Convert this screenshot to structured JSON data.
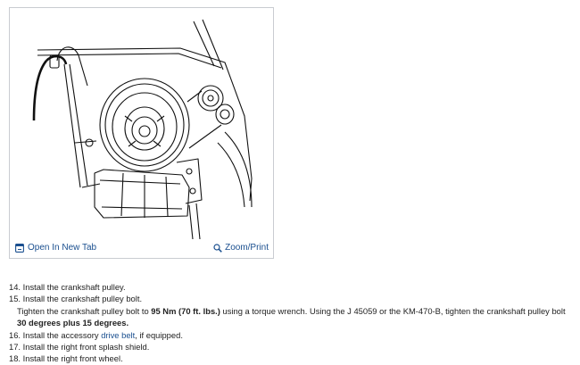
{
  "figure": {
    "open_label": "Open In New Tab",
    "zoom_label": "Zoom/Print",
    "open_icon": "new-tab-icon",
    "zoom_icon": "magnifier-icon"
  },
  "steps": {
    "s14": "14. Install the crankshaft pulley.",
    "s15": "15. Install the crankshaft pulley bolt.",
    "torque_pre": "Tighten the crankshaft pulley bolt to ",
    "torque_value": "95 Nm (70 ft. lbs.)",
    "torque_mid": " using a torque wrench. Using the J 45059 or the KM-470-B, tighten the crankshaft pulley bolt ",
    "torque_angle": "30 degrees plus 15 degrees.",
    "s16_pre": "16. Install the accessory ",
    "s16_link": "drive belt",
    "s16_post": ", if equipped.",
    "s17": "17. Install the right front splash shield.",
    "s18": "18. Install the right front wheel."
  },
  "colors": {
    "link": "#1a4f8f",
    "border": "#c9ccd1"
  }
}
